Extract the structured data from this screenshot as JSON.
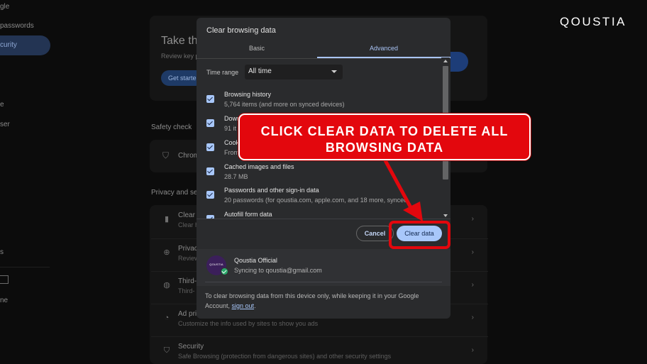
{
  "background": {
    "sidebar": {
      "items": [
        "gle",
        "passwords",
        "curity",
        "e",
        "ser",
        "s",
        "ne"
      ],
      "active_item": "curity"
    },
    "hero_card": {
      "title": "Take the",
      "subtitle": "Review key p",
      "button_label": "Get starte"
    },
    "safety_check": {
      "section_label": "Safety check",
      "row_label": "Chrom"
    },
    "privacy": {
      "section_label": "Privacy and se",
      "rows": [
        {
          "title": "Clear b",
          "subtitle": "Clear h"
        },
        {
          "title": "Privacy",
          "subtitle": "Review"
        },
        {
          "title": "Third-",
          "subtitle": "Third-"
        },
        {
          "title": "Ad pri",
          "subtitle": "Customize the info used by sites to show you ads"
        },
        {
          "title": "Security",
          "subtitle": "Safe Browsing (protection from dangerous sites) and other security settings"
        }
      ]
    }
  },
  "brand": {
    "logo": "QOUSTIA"
  },
  "dialog": {
    "title": "Clear browsing data",
    "tabs": {
      "basic": "Basic",
      "advanced": "Advanced"
    },
    "time_range": {
      "label": "Time range",
      "value": "All time"
    },
    "items": [
      {
        "title": "Browsing history",
        "subtitle": "5,764 items (and more on synced devices)",
        "checked": true
      },
      {
        "title": "Down",
        "subtitle": "91 it",
        "checked": true
      },
      {
        "title": "Cook",
        "subtitle": "From",
        "checked": true
      },
      {
        "title": "Cached images and files",
        "subtitle": "28.7 MB",
        "checked": true
      },
      {
        "title": "Passwords and other sign-in data",
        "subtitle": "20 passwords (for qoustia.com, apple.com, and 18 more, synced",
        "checked": true
      },
      {
        "title": "Autofill form data",
        "subtitle": "",
        "checked": true
      }
    ],
    "buttons": {
      "cancel": "Cancel",
      "clear": "Clear data"
    },
    "account": {
      "name": "Qoustia Official",
      "sync_status": "Syncing to qoustia@gmail.com",
      "avatar_text": "QOUSTIA"
    },
    "footnote": {
      "text": "To clear browsing data from this device only, while keeping it in your Google Account, ",
      "link": "sign out",
      "end": "."
    }
  },
  "annotation": {
    "callout_line1": "CLICK CLEAR DATA TO DELETE ALL",
    "callout_line2": "BROWSING DATA",
    "color": "#e3070d"
  }
}
